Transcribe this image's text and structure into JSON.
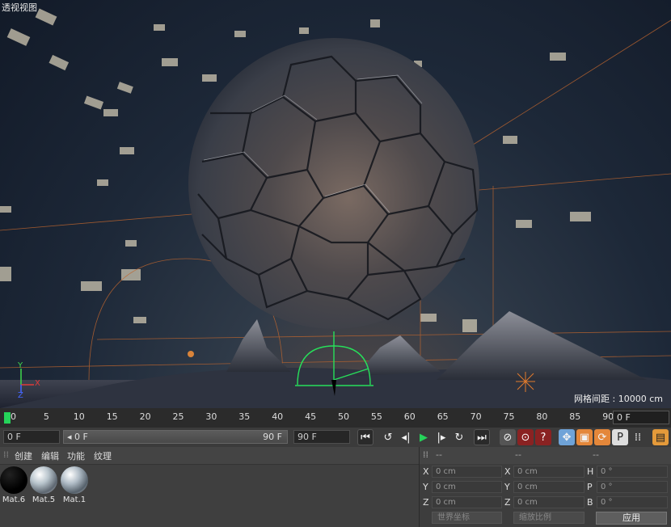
{
  "viewport": {
    "title": "透视视图",
    "grid_readout": "网格间距 : 10000 cm",
    "axis_labels": {
      "x": "X",
      "y": "Y",
      "z": "Z"
    }
  },
  "timeline": {
    "ticks": [
      "0",
      "5",
      "10",
      "15",
      "20",
      "25",
      "30",
      "35",
      "40",
      "45",
      "50",
      "55",
      "60",
      "65",
      "70",
      "75",
      "80",
      "85",
      "90"
    ],
    "end_frame": "0 F",
    "accent": "#25d35a"
  },
  "transport": {
    "current_frame": "0 F",
    "range_start": "◂ 0 F",
    "range_end": "90 F",
    "max_frame": "90 F"
  },
  "material_manager": {
    "menu": [
      "创建",
      "编辑",
      "功能",
      "纹理"
    ],
    "materials": [
      {
        "label": "Mat.6",
        "color": "#000000"
      },
      {
        "label": "Mat.5",
        "color": "#b8c4cc"
      },
      {
        "label": "Mat.1",
        "color": "#b0bcc6"
      }
    ]
  },
  "coordinates": {
    "headers": [
      "--",
      "--",
      "--"
    ],
    "rows": [
      {
        "a_label": "X",
        "a_val": "0 cm",
        "b_label": "X",
        "b_val": "0 cm",
        "c_label": "H",
        "c_val": "0 °"
      },
      {
        "a_label": "Y",
        "a_val": "0 cm",
        "b_label": "Y",
        "b_val": "0 cm",
        "c_label": "P",
        "c_val": "0 °"
      },
      {
        "a_label": "Z",
        "a_val": "0 cm",
        "b_label": "Z",
        "b_val": "0 cm",
        "c_label": "B",
        "c_val": "0 °"
      }
    ],
    "world_dropdown": "世界坐标",
    "scale_dropdown": "缩放比例",
    "apply": "应用"
  }
}
